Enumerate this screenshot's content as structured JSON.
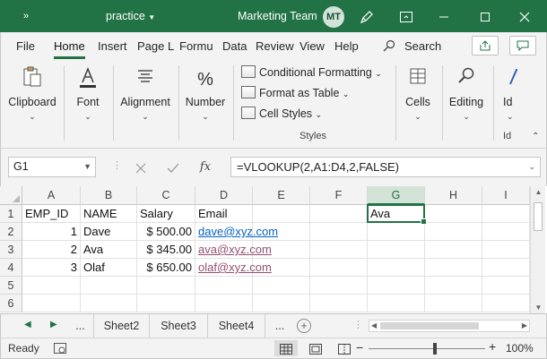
{
  "titlebar": {
    "expand_icon": "»",
    "doc_title": "practice",
    "team_name": "Marketing Team",
    "avatar_initials": "MT",
    "accent": "#217346"
  },
  "menu": {
    "tabs": [
      "File",
      "Home",
      "Insert",
      "Page L",
      "Formu",
      "Data",
      "Review",
      "View",
      "Help"
    ],
    "active": "Home",
    "search_label": "Search"
  },
  "ribbon": {
    "clipboard": "Clipboard",
    "font": "Font",
    "alignment": "Alignment",
    "number": "Number",
    "conditional_formatting": "Conditional Formatting",
    "format_as_table": "Format as Table",
    "cell_styles": "Cell Styles",
    "styles_group": "Styles",
    "cells": "Cells",
    "editing": "Editing",
    "ideas_cut": "Id",
    "ideas_group_cut": "Id"
  },
  "formula_bar": {
    "name_box": "G1",
    "fx": "fx",
    "formula": "=VLOOKUP(2,A1:D4,2,FALSE)"
  },
  "grid": {
    "columns": [
      "A",
      "B",
      "C",
      "D",
      "E",
      "F",
      "G",
      "H",
      "I"
    ],
    "rows": [
      "1",
      "2",
      "3",
      "4",
      "5",
      "6"
    ],
    "selected_column": "G",
    "selected_cell": "G1",
    "cells": {
      "A1": "EMP_ID",
      "B1": "NAME",
      "C1": "Salary",
      "D1": "Email",
      "G1": "Ava",
      "A2": "1",
      "B2": "Dave",
      "C2": "$ 500.00",
      "D2": "dave@xyz.com",
      "A3": "2",
      "B3": "Ava",
      "C3": "$ 345.00",
      "D3": "ava@xyz.com",
      "A4": "3",
      "B4": "Olaf",
      "C4": "$ 650.00",
      "D4": "olaf@xyz.com"
    }
  },
  "sheets": {
    "ellipsis_left": "...",
    "tabs": [
      "Sheet2",
      "Sheet3",
      "Sheet4"
    ],
    "ellipsis_right": "...",
    "add": "+"
  },
  "status": {
    "ready": "Ready",
    "zoom": "100%",
    "minus": "−",
    "plus": "+"
  }
}
